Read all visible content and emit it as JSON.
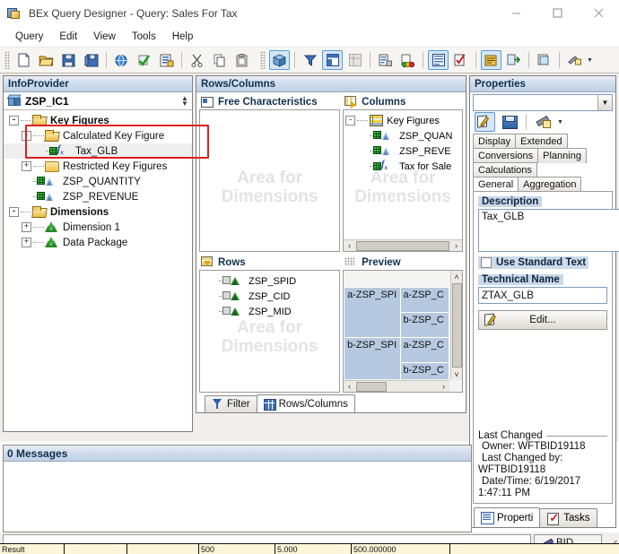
{
  "window": {
    "title": "BEx Query Designer - Query: Sales For Tax",
    "app_icon": "bex-app-icon",
    "controls": {
      "minimize": "minimize-icon",
      "maximize": "maximize-icon",
      "close": "close-icon"
    }
  },
  "menubar": {
    "items": [
      {
        "label": "Query"
      },
      {
        "label": "Edit"
      },
      {
        "label": "View"
      },
      {
        "label": "Tools"
      },
      {
        "label": "Help"
      }
    ]
  },
  "toolbar": {
    "groups": [
      {
        "buttons": [
          {
            "name": "new-query-icon",
            "active": false
          },
          {
            "name": "open-query-icon",
            "active": false
          },
          {
            "name": "save-query-icon",
            "active": false
          },
          {
            "name": "save-as-query-icon",
            "active": false
          },
          {
            "name": "sep",
            "active": false
          },
          {
            "name": "publish-globe-icon",
            "active": false
          },
          {
            "name": "check-query-icon",
            "active": false
          },
          {
            "name": "query-properties-icon",
            "active": false
          },
          {
            "name": "sep",
            "active": false
          },
          {
            "name": "cut-icon",
            "active": false
          },
          {
            "name": "copy-icon",
            "active": false
          },
          {
            "name": "paste-icon",
            "active": false
          }
        ]
      },
      {
        "buttons": [
          {
            "name": "infoprovider-cube-icon",
            "active": true
          },
          {
            "name": "sep",
            "active": false
          },
          {
            "name": "filter-icon",
            "active": false
          },
          {
            "name": "rows-columns-icon",
            "active": true
          },
          {
            "name": "cells-icon",
            "active": false
          },
          {
            "name": "sep",
            "active": false
          },
          {
            "name": "conditions-icon",
            "active": false
          },
          {
            "name": "exceptions-icon",
            "active": false
          },
          {
            "name": "sep",
            "active": false
          },
          {
            "name": "properties-icon",
            "active": true
          },
          {
            "name": "tasks-icon",
            "active": false
          },
          {
            "name": "sep",
            "active": false
          },
          {
            "name": "messages-icon",
            "active": true
          },
          {
            "name": "goto-icon",
            "active": false
          },
          {
            "name": "sep",
            "active": false
          },
          {
            "name": "document-icon",
            "active": false
          },
          {
            "name": "sep",
            "active": false
          },
          {
            "name": "settings-wrench-icon",
            "active": false
          }
        ]
      }
    ]
  },
  "infoprovider": {
    "title": "InfoProvider",
    "selected": "ZSP_IC1",
    "selected_icon": "cube-icon",
    "spinner": "spinner-up-down-icon",
    "tree": [
      {
        "level": 0,
        "label": "Key Figures",
        "icon": "folder-open-icon",
        "expander": "-",
        "bold": true
      },
      {
        "level": 1,
        "label": "Calculated Key Figure",
        "icon": "folder-open-icon",
        "expander": "-",
        "bold": false
      },
      {
        "level": 2,
        "label": "Tax_GLB",
        "icon": "formula-key-figure-icon",
        "expander": "",
        "bold": false,
        "selected": true
      },
      {
        "level": 1,
        "label": "Restricted Key Figures",
        "icon": "folder-icon",
        "expander": "+",
        "bold": false
      },
      {
        "level": 1,
        "label": "ZSP_QUANTITY",
        "icon": "key-figure-icon",
        "expander": "",
        "bold": false
      },
      {
        "level": 1,
        "label": "ZSP_REVENUE",
        "icon": "key-figure-icon",
        "expander": "",
        "bold": false
      },
      {
        "level": 0,
        "label": "Dimensions",
        "icon": "folder-open-icon",
        "expander": "-",
        "bold": true
      },
      {
        "level": 1,
        "label": "Dimension 1",
        "icon": "dimension-icon",
        "expander": "+",
        "bold": false
      },
      {
        "level": 1,
        "label": "Data Package",
        "icon": "dimension-icon",
        "expander": "+",
        "bold": false
      }
    ]
  },
  "rows_columns": {
    "title": "Rows/Columns",
    "free_characteristics": {
      "label": "Free Characteristics",
      "icon": "free-characteristics-icon",
      "watermark": "Area for Dimensions",
      "items": []
    },
    "columns": {
      "label": "Columns",
      "icon": "columns-icon",
      "watermark": "Area for Dimensions",
      "items": [
        {
          "level": 0,
          "label": "Key Figures",
          "icon": "key-figures-group-icon",
          "expander": "-"
        },
        {
          "level": 1,
          "label": "ZSP_QUAN",
          "icon": "key-figure-icon",
          "expander": ""
        },
        {
          "level": 1,
          "label": "ZSP_REVE",
          "icon": "key-figure-icon",
          "expander": ""
        },
        {
          "level": 1,
          "label": "Tax for Sale",
          "icon": "formula-key-figure-icon",
          "expander": ""
        }
      ]
    },
    "rows": {
      "label": "Rows",
      "icon": "rows-icon",
      "watermark": "Area for Dimensions",
      "items": [
        {
          "level": 0,
          "label": "ZSP_SPID",
          "icon": "characteristic-icon"
        },
        {
          "level": 0,
          "label": "ZSP_CID",
          "icon": "characteristic-icon"
        },
        {
          "level": 0,
          "label": "ZSP_MID",
          "icon": "characteristic-icon"
        }
      ]
    },
    "preview": {
      "label": "Preview",
      "icon": "preview-icon",
      "rows": [
        [
          {
            "text": "a-ZSP_SPI",
            "rowspan": 2
          },
          {
            "text": "a-ZSP_C"
          }
        ],
        [
          {
            "text": "b-ZSP_C"
          }
        ],
        [
          {
            "text": "b-ZSP_SPI",
            "rowspan": 2
          },
          {
            "text": "a-ZSP_C"
          }
        ],
        [
          {
            "text": "b-ZSP_C"
          }
        ]
      ]
    },
    "tabs": [
      {
        "label": "Filter",
        "icon": "filter-icon",
        "active": false
      },
      {
        "label": "Rows/Columns",
        "icon": "rows-columns-icon",
        "active": true
      }
    ]
  },
  "properties": {
    "title": "Properties",
    "combo_value": "",
    "combo_caret": "chevron-down-icon",
    "toolbar": [
      {
        "name": "edit-pencil-icon",
        "active": true
      },
      {
        "name": "save-disk-icon",
        "active": false
      },
      {
        "name": "sep",
        "active": false
      },
      {
        "name": "settings-wrench-icon",
        "active": false
      }
    ],
    "tab_rows": [
      [
        {
          "label": "Display",
          "active": false
        },
        {
          "label": "Extended",
          "active": false
        }
      ],
      [
        {
          "label": "Conversions",
          "active": false
        },
        {
          "label": "Planning",
          "active": false
        }
      ],
      [
        {
          "label": "Calculations",
          "active": false
        }
      ],
      [
        {
          "label": "General",
          "active": true
        },
        {
          "label": "Aggregation",
          "active": false
        }
      ]
    ],
    "description": {
      "label": "Description",
      "value": "Tax_GLB",
      "button_icon": "text-variable-icon",
      "caret_icon": "chevron-down-icon"
    },
    "use_standard_text": {
      "label": "Use Standard Text",
      "checked": false
    },
    "technical_name": {
      "label": "Technical Name",
      "value": "ZTAX_GLB"
    },
    "edit_button": {
      "label": "Edit...",
      "icon": "edit-pencil-icon"
    },
    "last_changed": {
      "title": "Last Changed",
      "owner_label": "Owner: WFTBID19118",
      "changed_by_label": "Last Changed by:",
      "changed_by_value": "WFTBID19118",
      "datetime_label": "Date/Time: 6/19/2017",
      "time_value": "1:47:11 PM"
    },
    "tabs": [
      {
        "label": "Properti",
        "icon": "properties-icon",
        "active": true
      },
      {
        "label": "Tasks",
        "icon": "tasks-icon",
        "active": false
      }
    ]
  },
  "messages": {
    "title": "0 Messages",
    "body": ""
  },
  "statusbar": {
    "field": "",
    "bid_label": "BID",
    "bid_icon": "bid-icon",
    "resize_grip": "resize-grip-icon"
  },
  "annotation": {
    "color": "#e02020",
    "target": "Calculated Key Figure / Tax_GLB"
  },
  "background_sheet": {
    "cells": [
      "Result",
      "",
      "",
      "500",
      "5.000",
      "500.000000"
    ]
  }
}
